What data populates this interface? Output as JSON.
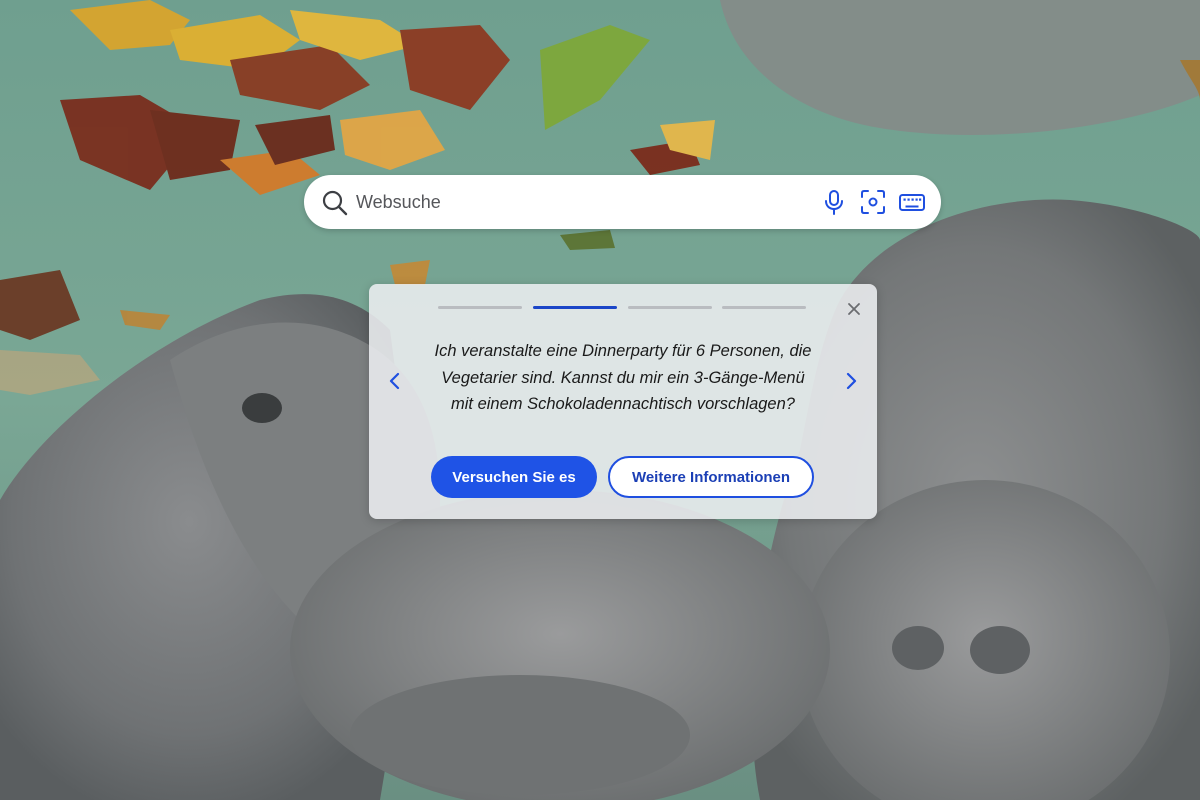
{
  "search": {
    "placeholder": "Websuche",
    "icons": [
      "search-icon",
      "microphone-icon",
      "visual-search-icon",
      "keyboard-icon"
    ]
  },
  "suggestion_card": {
    "progress": {
      "total_steps": 4,
      "active_step": 2
    },
    "prompt": "Ich veranstalte eine Dinnerparty für 6 Personen, die Vegetarier sind. Kannst du mir ein 3-Gänge-Menü mit einem Schokoladennachtisch vorschlagen?",
    "try_label": "Versuchen Sie es",
    "more_info_label": "Weitere Informationen",
    "icons": [
      "close-icon",
      "chevron-left-icon",
      "chevron-right-icon"
    ]
  },
  "colors": {
    "accent": "#1f53e6",
    "progress_active": "#1b46c8",
    "progress_inactive": "#b9bcc0"
  }
}
